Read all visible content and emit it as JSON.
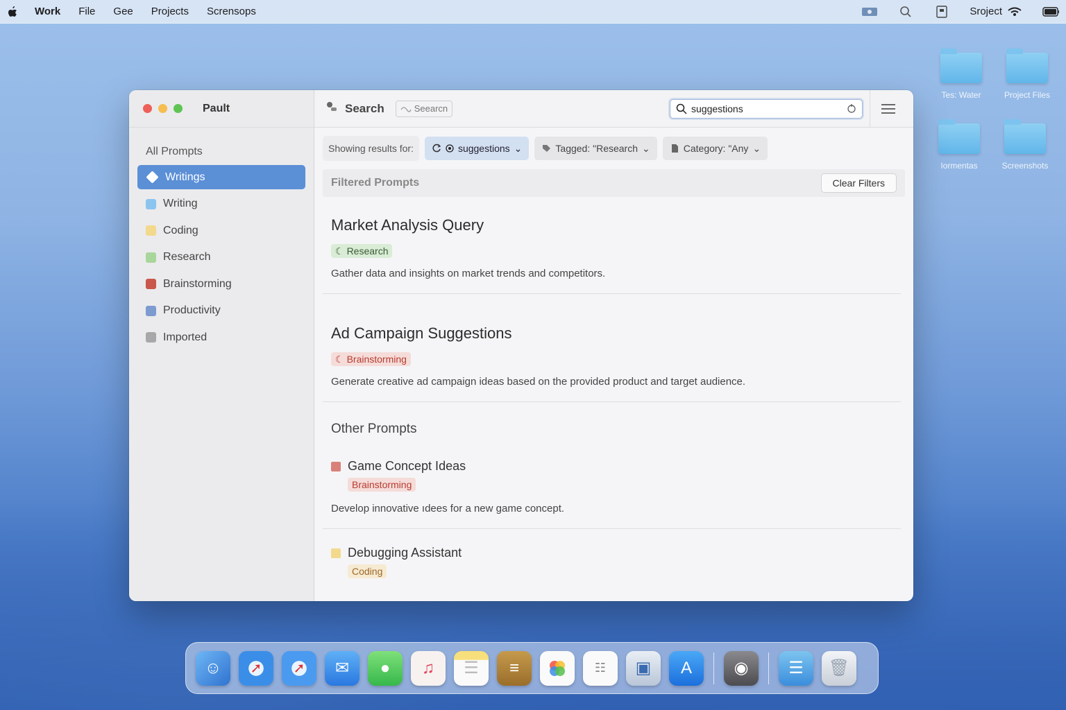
{
  "menubar": {
    "items": [
      "Work",
      "File",
      "Gee",
      "Projects",
      "Scrensops"
    ],
    "right_label": "Sroject"
  },
  "desktop": {
    "folders": [
      {
        "label": "Tes: Water"
      },
      {
        "label": "Project Files"
      },
      {
        "label": "Iormentas"
      },
      {
        "label": "Screenshots"
      }
    ]
  },
  "window": {
    "app_title": "Pault",
    "toolbar": {
      "title": "Search",
      "tag_label": "Seearcn",
      "search_value": "suggestions"
    },
    "sidebar": {
      "all_label": "All Prompts",
      "items": [
        {
          "label": "Writings",
          "color": "#ffffff"
        },
        {
          "label": "Writing",
          "color": "#8cc4f0"
        },
        {
          "label": "Coding",
          "color": "#f2d98c"
        },
        {
          "label": "Research",
          "color": "#a9d69b"
        },
        {
          "label": "Brainstorming",
          "color": "#c9574c"
        },
        {
          "label": "Productivity",
          "color": "#7e9bd0"
        },
        {
          "label": "Imported",
          "color": "#a8a8a8"
        }
      ]
    },
    "filters": {
      "label": "Showing results for:",
      "query_chip": "suggestions",
      "tag_chip": "Tagged: \"Research",
      "category_chip": "Category: \"Any"
    },
    "filtered": {
      "heading": "Filtered Prompts",
      "clear_label": "Clear Filters",
      "cards": [
        {
          "title": "Market Analysis Query",
          "tag": "Research",
          "desc": "Gather data and insights on market trends and competitors."
        },
        {
          "title": "Ad Campaign Suggestions",
          "tag": "Brainstorming",
          "desc": "Generate creative ad campaign ideas based on the provided product and target audience."
        }
      ]
    },
    "other": {
      "heading": "Other Prompts",
      "items": [
        {
          "title": "Game Concept Ideas",
          "tag": "Brainstorming",
          "desc": "Develop innovative ıdees for a new game concept.",
          "color": "#d98078"
        },
        {
          "title": "Debugging Assistant",
          "tag": "Coding",
          "desc": "",
          "color": "#f2d98c"
        }
      ]
    }
  },
  "dock": {
    "icons": [
      "finder-icon",
      "safari-icon",
      "safari-icon",
      "mail-icon",
      "messages-icon",
      "music-icon",
      "notes-icon",
      "books-icon",
      "photos-icon",
      "reminders-icon",
      "preview-icon",
      "app-store-icon",
      "screenshot-icon",
      "downloads-folder-icon",
      "trash-icon"
    ]
  }
}
